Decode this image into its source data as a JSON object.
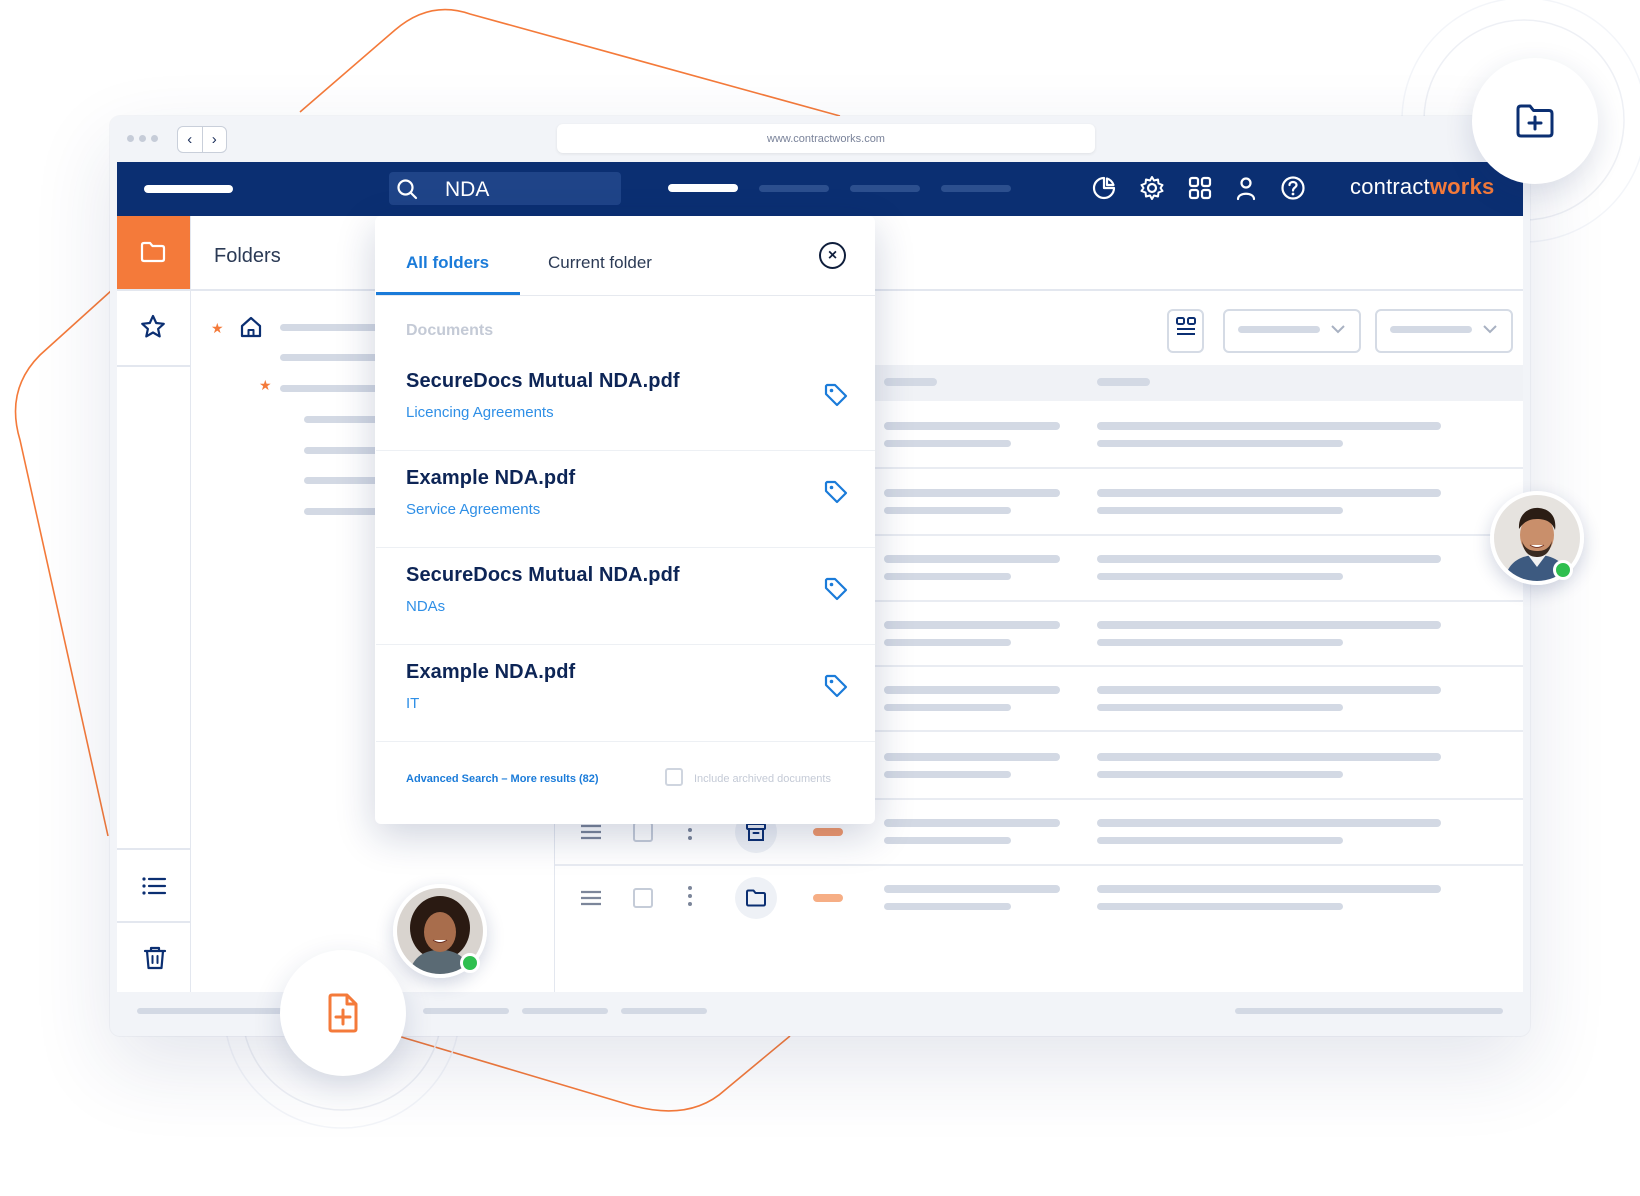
{
  "browser": {
    "url": "www.contractworks.com",
    "back_label": "‹",
    "forward_label": "›"
  },
  "header": {
    "search_value": "NDA",
    "logo_part1": "contract",
    "logo_part2": "works",
    "icons": [
      "pie-chart-icon",
      "gear-icon",
      "grid-icon",
      "user-icon",
      "help-icon"
    ]
  },
  "sidebar": {
    "icons": [
      "folder-icon",
      "star-icon",
      "list-icon",
      "trash-icon"
    ],
    "accent": "#f47a3a"
  },
  "folders_panel": {
    "title": "Folders"
  },
  "search_popup": {
    "tabs": [
      "All folders",
      "Current folder"
    ],
    "active_tab": "All folders",
    "close_label": "×",
    "section_label": "Documents",
    "results": [
      {
        "name": "SecureDocs Mutual NDA.pdf",
        "folder": "Licencing Agreements"
      },
      {
        "name": "Example NDA.pdf",
        "folder": "Service Agreements"
      },
      {
        "name": "SecureDocs Mutual NDA.pdf",
        "folder": "NDAs"
      },
      {
        "name": "Example NDA.pdf",
        "folder": "IT"
      }
    ],
    "advanced_search_label": "Advanced Search – More results (82)",
    "include_archived_label": "Include archived documents",
    "include_archived_checked": false
  },
  "colors": {
    "navy": "#0b2f72",
    "orange": "#f47a3a",
    "link_blue": "#1a7bd9",
    "online_green": "#2fbf4f"
  }
}
